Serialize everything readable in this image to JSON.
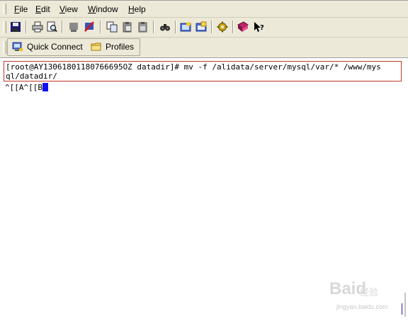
{
  "menu": {
    "items": [
      {
        "label": "File",
        "mnemonic": "F",
        "rest": "ile"
      },
      {
        "label": "Edit",
        "mnemonic": "E",
        "rest": "dit"
      },
      {
        "label": "View",
        "mnemonic": "V",
        "rest": "iew"
      },
      {
        "label": "Window",
        "mnemonic": "W",
        "rest": "indow"
      },
      {
        "label": "Help",
        "mnemonic": "H",
        "rest": "elp"
      }
    ]
  },
  "toolbar": {
    "icons": [
      "save-icon",
      "print-icon",
      "print-preview-icon",
      "disconnect-icon",
      "disconnect-all-icon",
      "copy-icon",
      "paste-icon",
      "paste-alt-icon",
      "find-icon",
      "new-file-transfer-icon",
      "new-window-icon",
      "settings-icon",
      "help-topics-icon",
      "context-help-icon"
    ]
  },
  "quick": {
    "connect_label": "Quick Connect",
    "profiles_label": "Profiles"
  },
  "terminal": {
    "line1": "[root@AY13061801180766695OZ datadir]# mv -f /alidata/server/mysql/var/* /www/mys",
    "line2": "ql/datadir/",
    "line3": "^[[A^[[B"
  },
  "watermark": {
    "logo": "Baid",
    "sub": "经验",
    "url": "jingyan.baidu.com"
  },
  "colors": {
    "chrome": "#ece9d8",
    "highlight_border": "#c0392b",
    "cursor": "#1010ee"
  }
}
